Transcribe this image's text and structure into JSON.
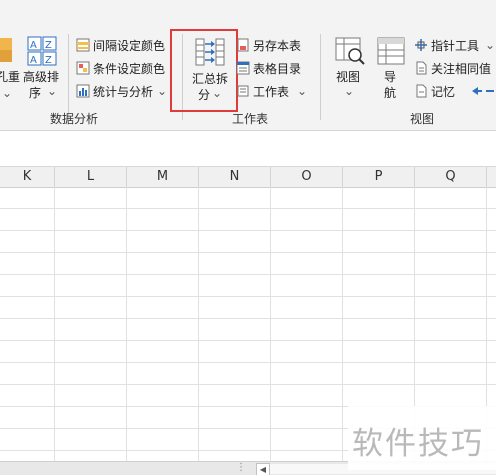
{
  "ribbon": {
    "partial_left_label_1": "孔重",
    "partial_left_label_2": "⌄",
    "advanced_sort": {
      "line1": "高级排",
      "line2": "序",
      "caret": "⌄"
    },
    "data_analysis": {
      "alt_row_color": "间隔设定颜色",
      "cond_color": "条件设定颜色",
      "stats_analysis": "统计与分析",
      "stats_caret": "⌄",
      "group_label": "数据分析"
    },
    "worksheet": {
      "summary_split": {
        "line1": "汇总拆",
        "line2": "分",
        "caret": "⌄"
      },
      "save_sheet": "另存本表",
      "table_toc": "表格目录",
      "worksheet_menu": "工作表",
      "worksheet_caret": "⌄",
      "group_label": "工作表"
    },
    "view": {
      "view_btn": "视图",
      "view_caret": "⌄",
      "nav_line1": "导",
      "nav_line2": "航",
      "pointer_tool": "指针工具",
      "pointer_caret": "⌄",
      "follow_same": "关注相同值",
      "memo": "记忆",
      "group_label": "视图"
    }
  },
  "columns": [
    "K",
    "L",
    "M",
    "N",
    "O",
    "P",
    "Q"
  ],
  "bottom": {
    "dots": "⋮",
    "scroll_left": "◀"
  },
  "watermark": "软件技巧",
  "colors": {
    "highlight": "#e03b3b",
    "accent_blue": "#2e6fbf"
  }
}
